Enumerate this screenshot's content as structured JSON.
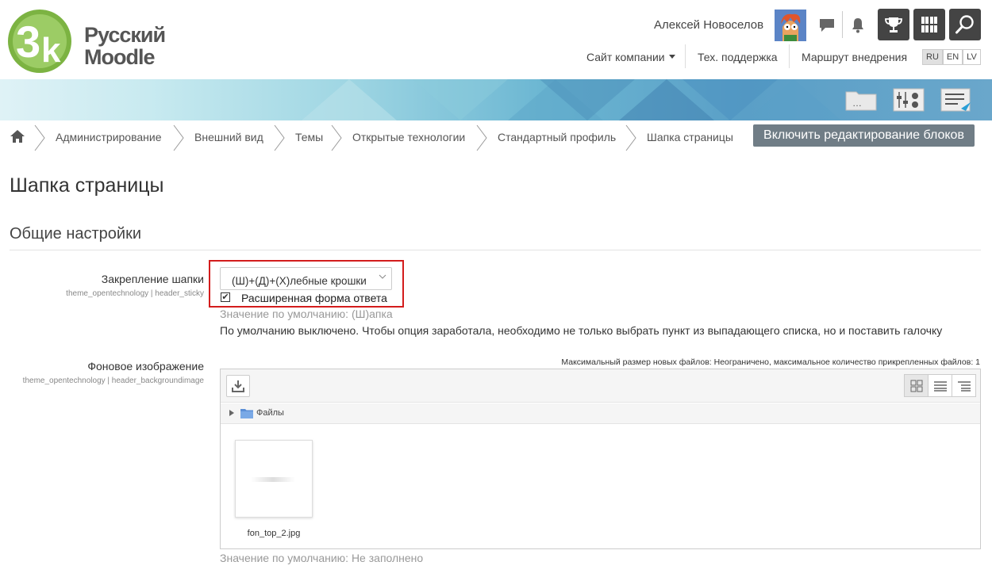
{
  "header": {
    "logo_line1": "Русский",
    "logo_line2": "Moodle",
    "user_name": "Алексей Новоселов",
    "nav": {
      "company": "Сайт компании",
      "support": "Тех. поддержка",
      "route": "Маршрут внедрения"
    },
    "languages": [
      "RU",
      "EN",
      "LV"
    ],
    "active_language": "RU"
  },
  "breadcrumb": {
    "items": [
      "Администрирование",
      "Внешний вид",
      "Темы",
      "Открытые технологии",
      "Стандартный профиль",
      "Шапка страницы"
    ],
    "edit_button": "Включить редактирование блоков"
  },
  "page": {
    "title": "Шапка страницы",
    "section_title": "Общие настройки"
  },
  "settings": {
    "sticky": {
      "label": "Закрепление шапки",
      "sub": "theme_opentechnology | header_sticky",
      "select_value": "(Ш)+(Д)+(Х)лебные крошки",
      "checkbox_label": "Расширенная форма ответа",
      "checkbox_checked": true,
      "default": "Значение по умолчанию: (Ш)апка",
      "description": "По умолчанию выключено. Чтобы опция заработала, необходимо не только выбрать пункт из выпадающего списка, но и поставить галочку"
    },
    "background": {
      "label": "Фоновое изображение",
      "sub": "theme_opentechnology | header_backgroundimage",
      "max_size": "Максимальный размер новых файлов: Неограничено, максимальное количество прикрепленных файлов: 1",
      "path_label": "Файлы",
      "file_name": "fon_top_2.jpg",
      "default": "Значение по умолчанию: Не заполнено"
    }
  },
  "colors": {
    "highlight": "#d31c1c",
    "edit_button": "#707d86",
    "dark_button": "#444444",
    "logo_green": "#7cb342"
  }
}
